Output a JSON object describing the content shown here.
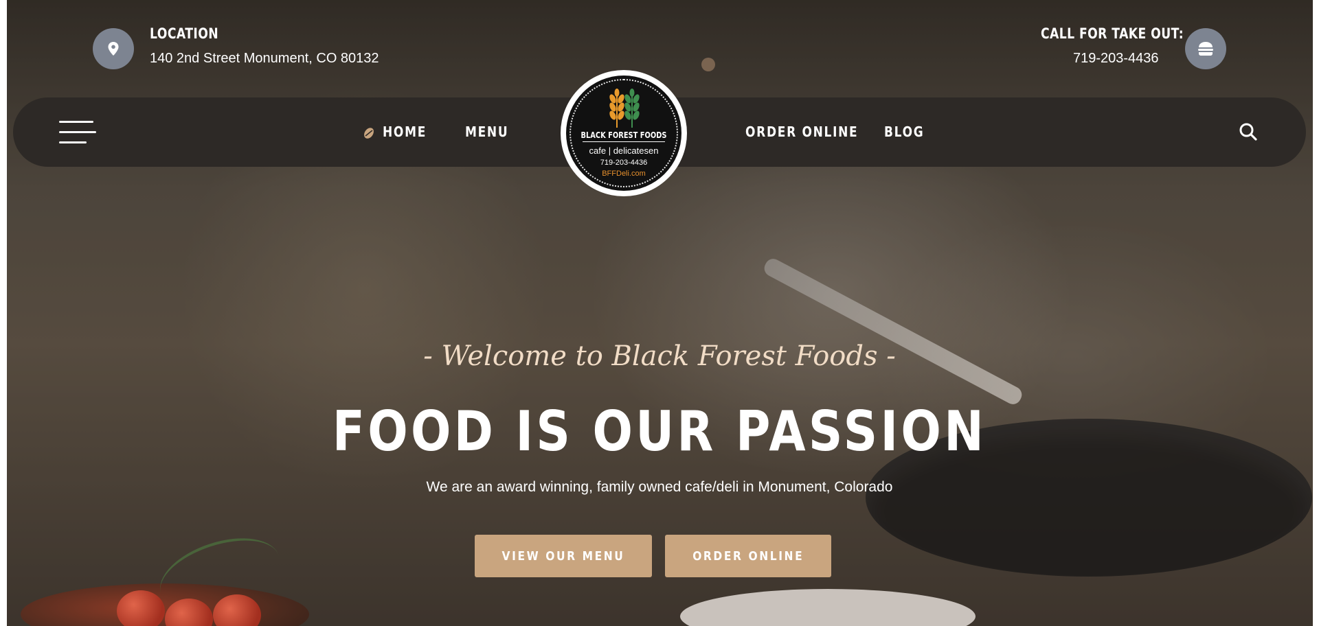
{
  "topbar": {
    "location_label": "LOCATION",
    "location_value": "140 2nd Street Monument, CO 80132",
    "takeout_label": "CALL FOR TAKE OUT:",
    "takeout_phone": "719-203-4436"
  },
  "nav": {
    "left": [
      {
        "label": "HOME"
      },
      {
        "label": "MENU"
      }
    ],
    "right": [
      {
        "label": "ORDER ONLINE"
      },
      {
        "label": "BLOG"
      }
    ]
  },
  "logo": {
    "name": "BLACK FOREST FOODS",
    "tagline": "cafe | delicatesen",
    "phone": "719-203-4436",
    "website": "BFFDeli.com"
  },
  "hero": {
    "welcome": "- Welcome to Black Forest Foods -",
    "headline": "FOOD IS OUR PASSION",
    "subline": "We are an award winning, family owned cafe/deli in Monument, Colorado",
    "buttons": [
      {
        "label": "VIEW OUR MENU"
      },
      {
        "label": "ORDER ONLINE"
      }
    ]
  },
  "icons": {
    "location": "map-pin-icon",
    "takeout": "burger-icon",
    "menu": "hamburger-menu-icon",
    "home": "coffee-bean-icon",
    "search": "search-icon"
  },
  "colors": {
    "navbar": "#2d2926",
    "button": "#c9a57f",
    "icon_circle": "#7d8491",
    "welcome_text": "#f1dcc6"
  }
}
